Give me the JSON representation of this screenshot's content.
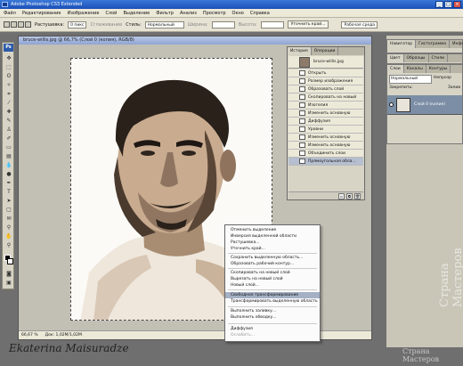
{
  "app": {
    "title": "Adobe Photoshop CS3 Extended"
  },
  "menu": [
    "Файл",
    "Редактирование",
    "Изображение",
    "Слой",
    "Выделение",
    "Фильтр",
    "Анализ",
    "Просмотр",
    "Окно",
    "Справка"
  ],
  "options": {
    "feather_label": "Растушевка:",
    "feather_value": "0 пикс",
    "antialias": "Сглаживание",
    "style_label": "Стиль:",
    "style_value": "Нормальный",
    "width_label": "Ширина:",
    "height_label": "Высота:",
    "refine_button": "Уточнить край...",
    "workspace": "Рабочая среда"
  },
  "document": {
    "title": "bruce-willis.jpg @ 66,7% (Слой 0 (копия), RGB/8)",
    "zoom": "66,67 %",
    "doc_size": "Док: 1,02M/1,02M"
  },
  "history": {
    "tabs": [
      "История",
      "Операции"
    ],
    "snapshot": "bruce-willis.jpg",
    "items": [
      "Открыть",
      "Размер изображения",
      "Образовать слой",
      "Скопировать на новый сл...",
      "Изогелия",
      "Изменить основную цвет...",
      "Диффузия",
      "Уровни",
      "Изменить основную цвет...",
      "Изменить основную цвет...",
      "Объединить слои",
      "Прямоугольная обла..."
    ],
    "selected_index": 11
  },
  "context_menu": {
    "items": [
      {
        "label": "Отменить выделение",
        "state": "normal"
      },
      {
        "label": "Инверсия выделенной области",
        "state": "normal"
      },
      {
        "label": "Растушевка...",
        "state": "normal"
      },
      {
        "label": "Уточнить край...",
        "state": "normal"
      },
      {
        "label": "Сохранить выделенную область...",
        "state": "normal"
      },
      {
        "label": "Образовать рабочий контур...",
        "state": "normal"
      },
      {
        "label": "Скопировать на новый слой",
        "state": "normal"
      },
      {
        "label": "Вырезать на новый слой",
        "state": "normal"
      },
      {
        "label": "Новый слой...",
        "state": "normal"
      },
      {
        "label": "Свободное трансформирование",
        "state": "highlighted"
      },
      {
        "label": "Трансформировать выделенную область",
        "state": "normal"
      },
      {
        "label": "Выполнить заливку...",
        "state": "normal"
      },
      {
        "label": "Выполнить обводку...",
        "state": "normal"
      },
      {
        "label": "Диффузия",
        "state": "normal"
      },
      {
        "label": "Ослабить...",
        "state": "disabled"
      }
    ]
  },
  "panels": {
    "nav_tabs": [
      "Навигатор",
      "Гистограмма",
      "Инфо"
    ],
    "color_tabs": [
      "Цвет",
      "Образцы",
      "Стили"
    ],
    "layer_tabs": [
      "Слои",
      "Каналы",
      "Контуры"
    ],
    "blend_mode": "Нормальный",
    "opacity_label": "Непрозр",
    "lock_label": "Закрепить:",
    "fill_label": "Залив",
    "layer_name": "Слой 0 (копия)"
  },
  "signature": "Ekaterina Maisuradze",
  "watermark": "Страна Мастеров",
  "colors": {
    "titlebar": "#1b4fb8",
    "highlight": "#a4b0c4",
    "layer_selected": "#7b8ea5"
  }
}
